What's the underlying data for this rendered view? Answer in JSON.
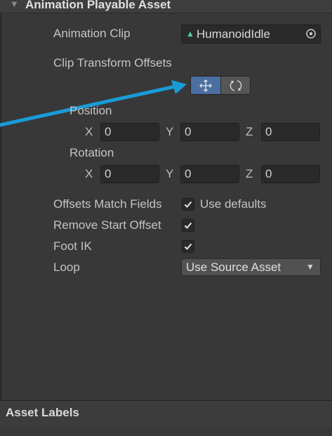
{
  "header": {
    "title": "Animation Playable Asset"
  },
  "animation_clip": {
    "label": "Animation Clip",
    "value": "HumanoidIdle"
  },
  "clip_transform": {
    "label": "Clip Transform Offsets"
  },
  "position": {
    "label": "Position",
    "x_label": "X",
    "y_label": "Y",
    "z_label": "Z",
    "x": "0",
    "y": "0",
    "z": "0"
  },
  "rotation": {
    "label": "Rotation",
    "x_label": "X",
    "y_label": "Y",
    "z_label": "Z",
    "x": "0",
    "y": "0",
    "z": "0"
  },
  "offsets_match": {
    "label": "Offsets Match Fields",
    "checkbox_text": "Use defaults",
    "checked": true
  },
  "remove_start": {
    "label": "Remove Start Offset",
    "checked": true
  },
  "foot_ik": {
    "label": "Foot IK",
    "checked": true
  },
  "loop": {
    "label": "Loop",
    "value": "Use Source Asset"
  },
  "asset_labels": {
    "title": "Asset Labels"
  },
  "colors": {
    "arrow": "#1a9bd8",
    "active_toggle": "#4a6fa0"
  }
}
